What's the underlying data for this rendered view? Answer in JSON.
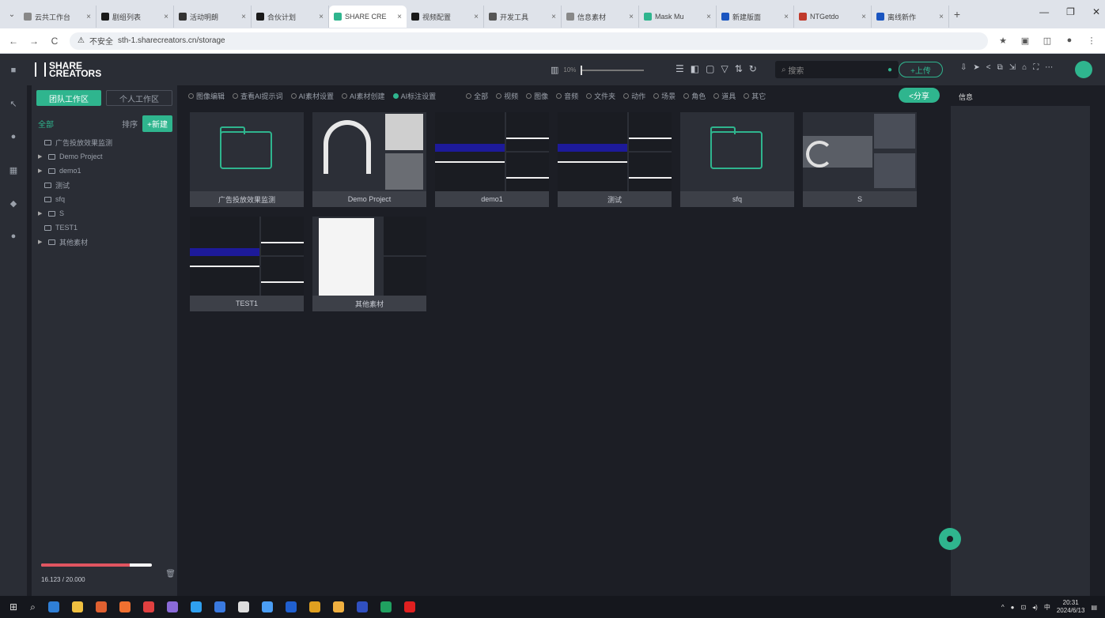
{
  "browser": {
    "tabs": [
      {
        "label": "云共工作台",
        "color": "#888888"
      },
      {
        "label": "剧组列表",
        "color": "#1a1a1a"
      },
      {
        "label": "活动明朗",
        "color": "#333333"
      },
      {
        "label": "合伙计划",
        "color": "#1a1a1a"
      },
      {
        "label": "SHARE CRE",
        "color": "#2fb58e"
      },
      {
        "label": "视频配置",
        "color": "#1a1a1a"
      },
      {
        "label": "开发工具",
        "color": "#555555"
      },
      {
        "label": "信息素材",
        "color": "#888888"
      },
      {
        "label": "Mask Mu",
        "color": "#2fb58e"
      },
      {
        "label": "新建版面",
        "color": "#1a55c0"
      },
      {
        "label": "NTGetdo",
        "color": "#c0392b"
      },
      {
        "label": "离线新作",
        "color": "#1a55c0"
      }
    ],
    "active_tab": 4,
    "new_tab": "+",
    "win_min": "—",
    "win_max": "❐",
    "win_close": "✕",
    "url_warning": "不安全",
    "url": "sth-1.sharecreators.cn/storage",
    "nav_back": "←",
    "nav_forward": "→",
    "nav_reload": "C"
  },
  "app": {
    "logo_line1": "SHARE",
    "logo_line2": "CREATORS",
    "zoom_label": "10%",
    "search_placeholder": "搜索",
    "upload_label": "+上传",
    "share_label": "<分享",
    "workspace_tabs": [
      "团队工作区",
      "个人工作区"
    ],
    "tree_all": "全部",
    "tree_sort": "排序",
    "new_button": "+新建",
    "tree": [
      {
        "label": "广告投放效果监测",
        "indent": true,
        "arrow": false
      },
      {
        "label": "Demo Project",
        "indent": false,
        "arrow": true
      },
      {
        "label": "demo1",
        "indent": false,
        "arrow": true
      },
      {
        "label": "测试",
        "indent": true,
        "arrow": false
      },
      {
        "label": "sfq",
        "indent": true,
        "arrow": false
      },
      {
        "label": "S",
        "indent": false,
        "arrow": true
      },
      {
        "label": "TEST1",
        "indent": true,
        "arrow": false
      },
      {
        "label": "其他素材",
        "indent": false,
        "arrow": true
      }
    ],
    "storage_text": "16.123 / 20.000",
    "storage_ratio": 0.8,
    "filters": [
      {
        "label": "图像编辑",
        "on": false
      },
      {
        "label": "查看AI提示词",
        "on": false
      },
      {
        "label": "AI素材设置",
        "on": false
      },
      {
        "label": "AI素材创建",
        "on": false
      },
      {
        "label": "AI标注设置",
        "on": true
      },
      {
        "label": "全部",
        "on": false
      },
      {
        "label": "视频",
        "on": false
      },
      {
        "label": "图像",
        "on": false
      },
      {
        "label": "音频",
        "on": false
      },
      {
        "label": "文件夹",
        "on": false
      },
      {
        "label": "动作",
        "on": false
      },
      {
        "label": "场景",
        "on": false
      },
      {
        "label": "角色",
        "on": false
      },
      {
        "label": "道具",
        "on": false
      },
      {
        "label": "其它",
        "on": false
      }
    ],
    "cards": [
      {
        "label": "广告投放效果监测",
        "kind": "folder"
      },
      {
        "label": "Demo Project",
        "kind": "headphones"
      },
      {
        "label": "demo1",
        "kind": "quad"
      },
      {
        "label": "测试",
        "kind": "quad"
      },
      {
        "label": "sfq",
        "kind": "folder"
      },
      {
        "label": "S",
        "kind": "moon"
      },
      {
        "label": "TEST1",
        "kind": "quad"
      },
      {
        "label": "其他素材",
        "kind": "paper"
      }
    ],
    "right_panel_title": "信息"
  },
  "taskbar": {
    "icons": [
      "#2f7fd6",
      "#f0c040",
      "#e06030",
      "#f07030",
      "#e04040",
      "#8a6ad8",
      "#2fa0f0",
      "#3a7ae0",
      "#ddd",
      "#4b9ef5",
      "#2060d0",
      "#e0a020",
      "#f0b040",
      "#3050c0",
      "#20a060",
      "#e02020"
    ],
    "time": "20:31",
    "date": "2024/6/13",
    "ime": "中"
  }
}
